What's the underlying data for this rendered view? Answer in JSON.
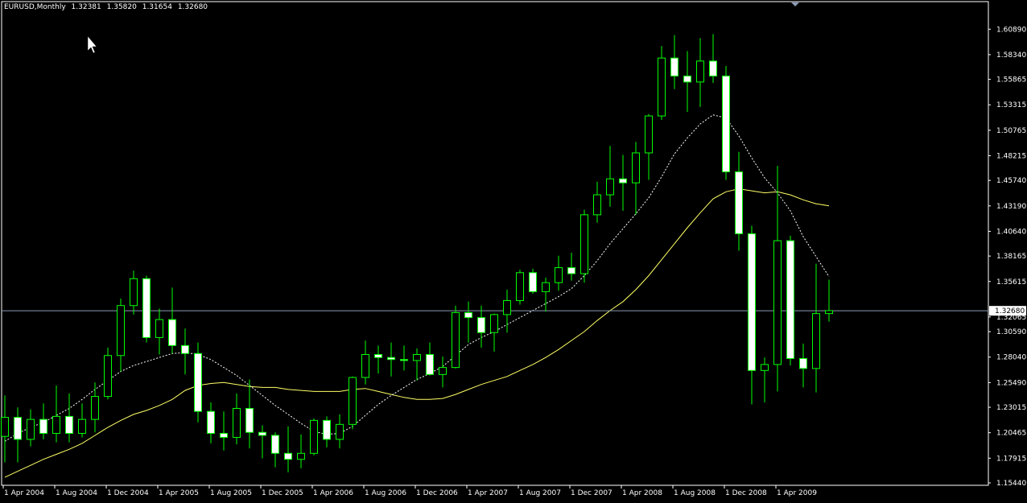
{
  "header": {
    "symbol": "EURUSD,Monthly",
    "open": "1.32381",
    "high": "1.35820",
    "low": "1.31654",
    "close": "1.32680"
  },
  "colors": {
    "background": "#000000",
    "grid_frame": "#ffffff",
    "bull_candle_body": "#000000",
    "bear_candle_body": "#ffffff",
    "wick": "#00ff00",
    "ma_fast": "#ffffff",
    "ma_slow": "#ffff66",
    "price_line": "#8a9bb5"
  },
  "chart_data": {
    "type": "candlestick",
    "title": "",
    "xlabel": "",
    "ylabel": "",
    "ylim": [
      1.1544,
      1.618
    ],
    "current_price": 1.3268,
    "current_price_label": "1.32680",
    "y_ticks": [
      "1.60890",
      "1.58340",
      "1.55865",
      "1.53315",
      "1.50765",
      "1.48215",
      "1.45740",
      "1.43190",
      "1.40640",
      "1.38165",
      "1.35615",
      "1.32065",
      "1.30590",
      "1.28040",
      "1.25490",
      "1.23015",
      "1.20465",
      "1.17915",
      "1.15440"
    ],
    "x_tick_labels": [
      "1 Apr 2004",
      "1 Aug 2004",
      "1 Dec 2004",
      "1 Apr 2005",
      "1 Aug 2005",
      "1 Dec 2005",
      "1 Apr 2006",
      "1 Aug 2006",
      "1 Dec 2006",
      "1 Apr 2007",
      "1 Aug 2007",
      "1 Dec 2007",
      "1 Apr 2008",
      "1 Aug 2008",
      "1 Dec 2008",
      "1 Apr 2009"
    ],
    "candles": [
      {
        "o": 1.201,
        "h": 1.242,
        "l": 1.175,
        "c": 1.22
      },
      {
        "o": 1.22,
        "h": 1.23,
        "l": 1.175,
        "c": 1.198
      },
      {
        "o": 1.198,
        "h": 1.228,
        "l": 1.191,
        "c": 1.218
      },
      {
        "o": 1.218,
        "h": 1.234,
        "l": 1.198,
        "c": 1.204
      },
      {
        "o": 1.204,
        "h": 1.252,
        "l": 1.195,
        "c": 1.221
      },
      {
        "o": 1.221,
        "h": 1.244,
        "l": 1.195,
        "c": 1.204
      },
      {
        "o": 1.204,
        "h": 1.234,
        "l": 1.2,
        "c": 1.218
      },
      {
        "o": 1.218,
        "h": 1.255,
        "l": 1.205,
        "c": 1.241
      },
      {
        "o": 1.241,
        "h": 1.29,
        "l": 1.238,
        "c": 1.282
      },
      {
        "o": 1.282,
        "h": 1.339,
        "l": 1.266,
        "c": 1.332
      },
      {
        "o": 1.332,
        "h": 1.367,
        "l": 1.323,
        "c": 1.359
      },
      {
        "o": 1.359,
        "h": 1.362,
        "l": 1.295,
        "c": 1.3
      },
      {
        "o": 1.3,
        "h": 1.329,
        "l": 1.283,
        "c": 1.318
      },
      {
        "o": 1.318,
        "h": 1.35,
        "l": 1.284,
        "c": 1.292
      },
      {
        "o": 1.292,
        "h": 1.309,
        "l": 1.263,
        "c": 1.284
      },
      {
        "o": 1.284,
        "h": 1.295,
        "l": 1.215,
        "c": 1.226
      },
      {
        "o": 1.226,
        "h": 1.235,
        "l": 1.194,
        "c": 1.204
      },
      {
        "o": 1.204,
        "h": 1.226,
        "l": 1.187,
        "c": 1.2
      },
      {
        "o": 1.2,
        "h": 1.244,
        "l": 1.193,
        "c": 1.229
      },
      {
        "o": 1.229,
        "h": 1.258,
        "l": 1.189,
        "c": 1.205
      },
      {
        "o": 1.205,
        "h": 1.212,
        "l": 1.179,
        "c": 1.202
      },
      {
        "o": 1.202,
        "h": 1.205,
        "l": 1.17,
        "c": 1.184
      },
      {
        "o": 1.184,
        "h": 1.211,
        "l": 1.165,
        "c": 1.178
      },
      {
        "o": 1.178,
        "h": 1.203,
        "l": 1.169,
        "c": 1.184
      },
      {
        "o": 1.184,
        "h": 1.219,
        "l": 1.182,
        "c": 1.217
      },
      {
        "o": 1.217,
        "h": 1.221,
        "l": 1.19,
        "c": 1.198
      },
      {
        "o": 1.198,
        "h": 1.223,
        "l": 1.189,
        "c": 1.213
      },
      {
        "o": 1.213,
        "h": 1.261,
        "l": 1.208,
        "c": 1.26
      },
      {
        "o": 1.26,
        "h": 1.297,
        "l": 1.253,
        "c": 1.283
      },
      {
        "o": 1.283,
        "h": 1.292,
        "l": 1.264,
        "c": 1.28
      },
      {
        "o": 1.28,
        "h": 1.295,
        "l": 1.261,
        "c": 1.278
      },
      {
        "o": 1.278,
        "h": 1.292,
        "l": 1.267,
        "c": 1.277
      },
      {
        "o": 1.277,
        "h": 1.289,
        "l": 1.257,
        "c": 1.283
      },
      {
        "o": 1.283,
        "h": 1.295,
        "l": 1.262,
        "c": 1.263
      },
      {
        "o": 1.263,
        "h": 1.281,
        "l": 1.25,
        "c": 1.27
      },
      {
        "o": 1.27,
        "h": 1.332,
        "l": 1.269,
        "c": 1.325
      },
      {
        "o": 1.325,
        "h": 1.336,
        "l": 1.295,
        "c": 1.32
      },
      {
        "o": 1.32,
        "h": 1.332,
        "l": 1.29,
        "c": 1.305
      },
      {
        "o": 1.305,
        "h": 1.324,
        "l": 1.286,
        "c": 1.323
      },
      {
        "o": 1.323,
        "h": 1.348,
        "l": 1.305,
        "c": 1.337
      },
      {
        "o": 1.337,
        "h": 1.368,
        "l": 1.333,
        "c": 1.365
      },
      {
        "o": 1.365,
        "h": 1.369,
        "l": 1.344,
        "c": 1.346
      },
      {
        "o": 1.346,
        "h": 1.36,
        "l": 1.326,
        "c": 1.355
      },
      {
        "o": 1.355,
        "h": 1.382,
        "l": 1.347,
        "c": 1.37
      },
      {
        "o": 1.37,
        "h": 1.385,
        "l": 1.357,
        "c": 1.364
      },
      {
        "o": 1.364,
        "h": 1.428,
        "l": 1.355,
        "c": 1.423
      },
      {
        "o": 1.423,
        "h": 1.456,
        "l": 1.415,
        "c": 1.443
      },
      {
        "o": 1.443,
        "h": 1.492,
        "l": 1.431,
        "c": 1.459
      },
      {
        "o": 1.459,
        "h": 1.483,
        "l": 1.427,
        "c": 1.455
      },
      {
        "o": 1.455,
        "h": 1.496,
        "l": 1.423,
        "c": 1.485
      },
      {
        "o": 1.485,
        "h": 1.524,
        "l": 1.458,
        "c": 1.522
      },
      {
        "o": 1.522,
        "h": 1.592,
        "l": 1.518,
        "c": 1.58
      },
      {
        "o": 1.58,
        "h": 1.603,
        "l": 1.549,
        "c": 1.562
      },
      {
        "o": 1.562,
        "h": 1.587,
        "l": 1.526,
        "c": 1.556
      },
      {
        "o": 1.556,
        "h": 1.6,
        "l": 1.531,
        "c": 1.577
      },
      {
        "o": 1.577,
        "h": 1.604,
        "l": 1.555,
        "c": 1.562
      },
      {
        "o": 1.562,
        "h": 1.572,
        "l": 1.458,
        "c": 1.466
      },
      {
        "o": 1.466,
        "h": 1.486,
        "l": 1.387,
        "c": 1.404
      },
      {
        "o": 1.404,
        "h": 1.412,
        "l": 1.233,
        "c": 1.267
      },
      {
        "o": 1.267,
        "h": 1.28,
        "l": 1.235,
        "c": 1.273
      },
      {
        "o": 1.273,
        "h": 1.472,
        "l": 1.246,
        "c": 1.397
      },
      {
        "o": 1.397,
        "h": 1.402,
        "l": 1.272,
        "c": 1.279
      },
      {
        "o": 1.279,
        "h": 1.294,
        "l": 1.25,
        "c": 1.269
      },
      {
        "o": 1.269,
        "h": 1.374,
        "l": 1.245,
        "c": 1.324
      },
      {
        "o": 1.324,
        "h": 1.358,
        "l": 1.316,
        "c": 1.327
      }
    ],
    "ma_fast": [
      1.196,
      1.204,
      1.21,
      1.215,
      1.222,
      1.229,
      1.238,
      1.248,
      1.257,
      1.266,
      1.272,
      1.276,
      1.28,
      1.284,
      1.285,
      1.283,
      1.278,
      1.27,
      1.262,
      1.252,
      1.242,
      1.232,
      1.223,
      1.214,
      1.206,
      1.203,
      1.204,
      1.211,
      1.222,
      1.233,
      1.242,
      1.25,
      1.258,
      1.264,
      1.271,
      1.282,
      1.293,
      1.3,
      1.306,
      1.313,
      1.32,
      1.327,
      1.334,
      1.341,
      1.349,
      1.362,
      1.377,
      1.394,
      1.409,
      1.424,
      1.44,
      1.461,
      1.484,
      1.5,
      1.514,
      1.523,
      1.52,
      1.502,
      1.48,
      1.46,
      1.445,
      1.427,
      1.401,
      1.381,
      1.361
    ],
    "ma_slow": [
      1.16,
      1.166,
      1.172,
      1.178,
      1.183,
      1.188,
      1.194,
      1.202,
      1.21,
      1.217,
      1.223,
      1.227,
      1.232,
      1.238,
      1.247,
      1.252,
      1.254,
      1.255,
      1.253,
      1.251,
      1.25,
      1.25,
      1.248,
      1.247,
      1.246,
      1.246,
      1.246,
      1.248,
      1.249,
      1.246,
      1.243,
      1.24,
      1.238,
      1.238,
      1.239,
      1.243,
      1.248,
      1.253,
      1.257,
      1.261,
      1.267,
      1.273,
      1.28,
      1.288,
      1.297,
      1.306,
      1.317,
      1.327,
      1.336,
      1.348,
      1.362,
      1.378,
      1.394,
      1.41,
      1.425,
      1.439,
      1.446,
      1.449,
      1.447,
      1.445,
      1.446,
      1.443,
      1.438,
      1.434,
      1.432
    ]
  }
}
